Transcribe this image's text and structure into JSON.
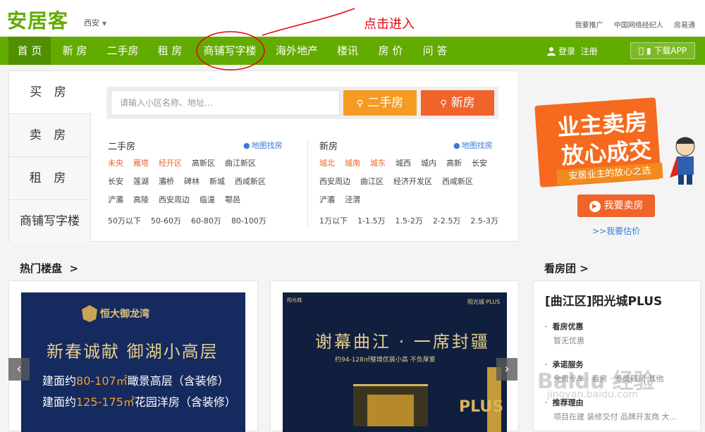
{
  "header": {
    "logo": "安居客",
    "city": "西安",
    "annotation": "点击进入",
    "top_links": [
      "我要推广",
      "中国网络经纪人",
      "房易通"
    ]
  },
  "nav": {
    "items": [
      "首 页",
      "新 房",
      "二手房",
      "租 房",
      "商铺写字楼",
      "海外地产",
      "楼讯",
      "房 价",
      "问 答"
    ],
    "login": "登录",
    "register": "注册",
    "app": "下载APP"
  },
  "search": {
    "tabs": [
      "买 房",
      "卖 房",
      "租 房",
      "商铺写字楼"
    ],
    "placeholder": "请输入小区名称、地址...",
    "btn_secondhand": "二手房",
    "btn_new": "新房",
    "secondhand": {
      "title": "二手房",
      "map": "地图找房",
      "rows": [
        [
          "未央",
          "雁塔",
          "经开区",
          "高新区",
          "曲江新区"
        ],
        [
          "长安",
          "莲湖",
          "灞桥",
          "碑林",
          "新城",
          "西咸新区"
        ],
        [
          "浐灞",
          "高陵",
          "西安周边",
          "临潼",
          "鄠邑"
        ]
      ],
      "prices": [
        "50万以下",
        "50-60万",
        "60-80万",
        "80-100万"
      ]
    },
    "newhouse": {
      "title": "新房",
      "map": "地图找房",
      "rows": [
        [
          "城北",
          "城南",
          "城东",
          "城西",
          "城内",
          "高新",
          "长安"
        ],
        [
          "西安周边",
          "曲江区",
          "经济开发区",
          "西咸新区"
        ],
        [
          "浐灞",
          "泾渭"
        ]
      ],
      "prices": [
        "1万以下",
        "1-1.5万",
        "1.5-2万",
        "2-2.5万",
        "2.5-3万"
      ]
    }
  },
  "promo": {
    "line1": "业主卖房",
    "line2": "放心成交",
    "slogan": "安居业主的放心之选",
    "sell_btn": "我要卖房",
    "estimate": ">>我要估价"
  },
  "hot": {
    "title": "热门楼盘",
    "arrow": ">",
    "ad1": {
      "brand": "恒大御龙湾",
      "brand_sub": "",
      "headline": "新春诚献  御湖小高层",
      "line1_a": "建面约",
      "line1_hl": "80-107㎡",
      "line1_b": "瞰景高层（含装修）",
      "line2_a": "建面约",
      "line2_hl": "125-175㎡",
      "line2_b": "花园洋房（含装修）"
    },
    "ad2": {
      "top_left": "阳光城",
      "top_right": "阳光城·PLUS",
      "headline": "谢幕曲江 · 一席封疆",
      "sub": "约94-128㎡璧境优装小高  不负厚爱",
      "plus": "PLUS"
    },
    "prev": "‹",
    "next": "›"
  },
  "team": {
    "title": "看房团",
    "arrow": ">",
    "project": "[曲江区]阳光城PLUS",
    "items": [
      {
        "label": "看房优惠",
        "value": "暂无优惠"
      },
      {
        "label": "承诺服务",
        "value": "免费专车 · 看房 · 专属顾问 其他"
      },
      {
        "label": "推荐理由",
        "value": "项目在建 装修交付 品牌开发商 大..."
      }
    ]
  },
  "watermark": {
    "main": "Baidu 经验",
    "sub": "jingyan.baidu.com"
  },
  "colors": {
    "brand_green": "#62ab00",
    "orange": "#f59b22",
    "red_orange": "#f0632a",
    "link_blue": "#3a7bd5"
  }
}
